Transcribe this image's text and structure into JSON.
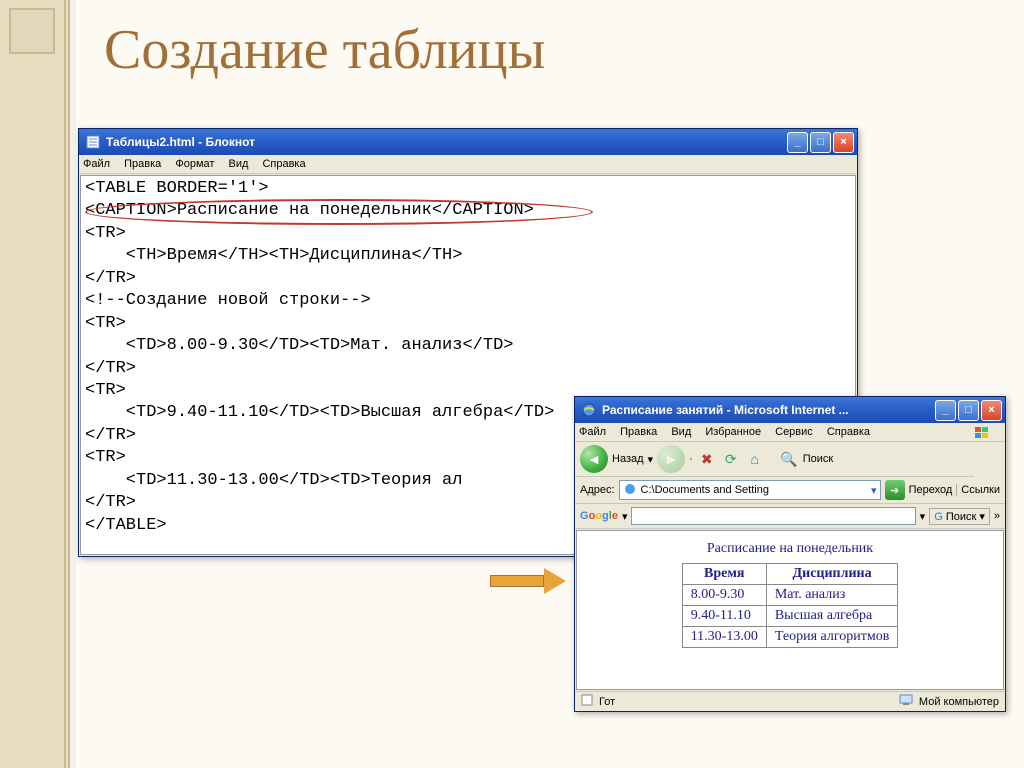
{
  "slide_title": "Создание таблицы",
  "notepad": {
    "title": "Таблицы2.html - Блокнот",
    "menu": [
      "Файл",
      "Правка",
      "Формат",
      "Вид",
      "Справка"
    ],
    "code_lines": [
      "<TABLE BORDER='1'>",
      "<CAPTION>Расписание на понедельник</CAPTION>",
      "<TR>",
      "    <TH>Время</TH><TH>Дисциплина</TH>",
      "</TR>",
      "<!--Создание новой строки-->",
      "<TR>",
      "    <TD>8.00-9.30</TD><TD>Мат. анализ</TD>",
      "</TR>",
      "<TR>",
      "    <TD>9.40-11.10</TD><TD>Высшая алгебра</TD>",
      "</TR>",
      "<TR>",
      "    <TD>11.30-13.00</TD><TD>Теория ал",
      "</TR>",
      "</TABLE>"
    ]
  },
  "ie": {
    "title": "Расписание занятий - Microsoft Internet ...",
    "menu": [
      "Файл",
      "Правка",
      "Вид",
      "Избранное",
      "Сервис",
      "Справка"
    ],
    "nav": {
      "back_label": "Назад",
      "search_label": "Поиск"
    },
    "addr": {
      "label": "Адрес:",
      "value": "C:\\Documents and Setting",
      "go_label": "Переход",
      "links_label": "Ссылки"
    },
    "googlebar": {
      "search_label": "Поиск",
      "more": "»"
    },
    "status": {
      "ready": "Гот",
      "my_computer": "Мой компьютер"
    }
  },
  "rendered": {
    "caption": "Расписание на понедельник",
    "headers": [
      "Время",
      "Дисциплина"
    ],
    "rows": [
      [
        "8.00-9.30",
        "Мат. анализ"
      ],
      [
        "9.40-11.10",
        "Высшая алгебра"
      ],
      [
        "11.30-13.00",
        "Теория алгоритмов"
      ]
    ]
  },
  "chart_data": {
    "type": "table",
    "title": "Расписание на понедельник",
    "columns": [
      "Время",
      "Дисциплина"
    ],
    "rows": [
      {
        "Время": "8.00-9.30",
        "Дисциплина": "Мат. анализ"
      },
      {
        "Время": "9.40-11.10",
        "Дисциплина": "Высшая алгебра"
      },
      {
        "Время": "11.30-13.00",
        "Дисциплина": "Теория алгоритмов"
      }
    ]
  }
}
